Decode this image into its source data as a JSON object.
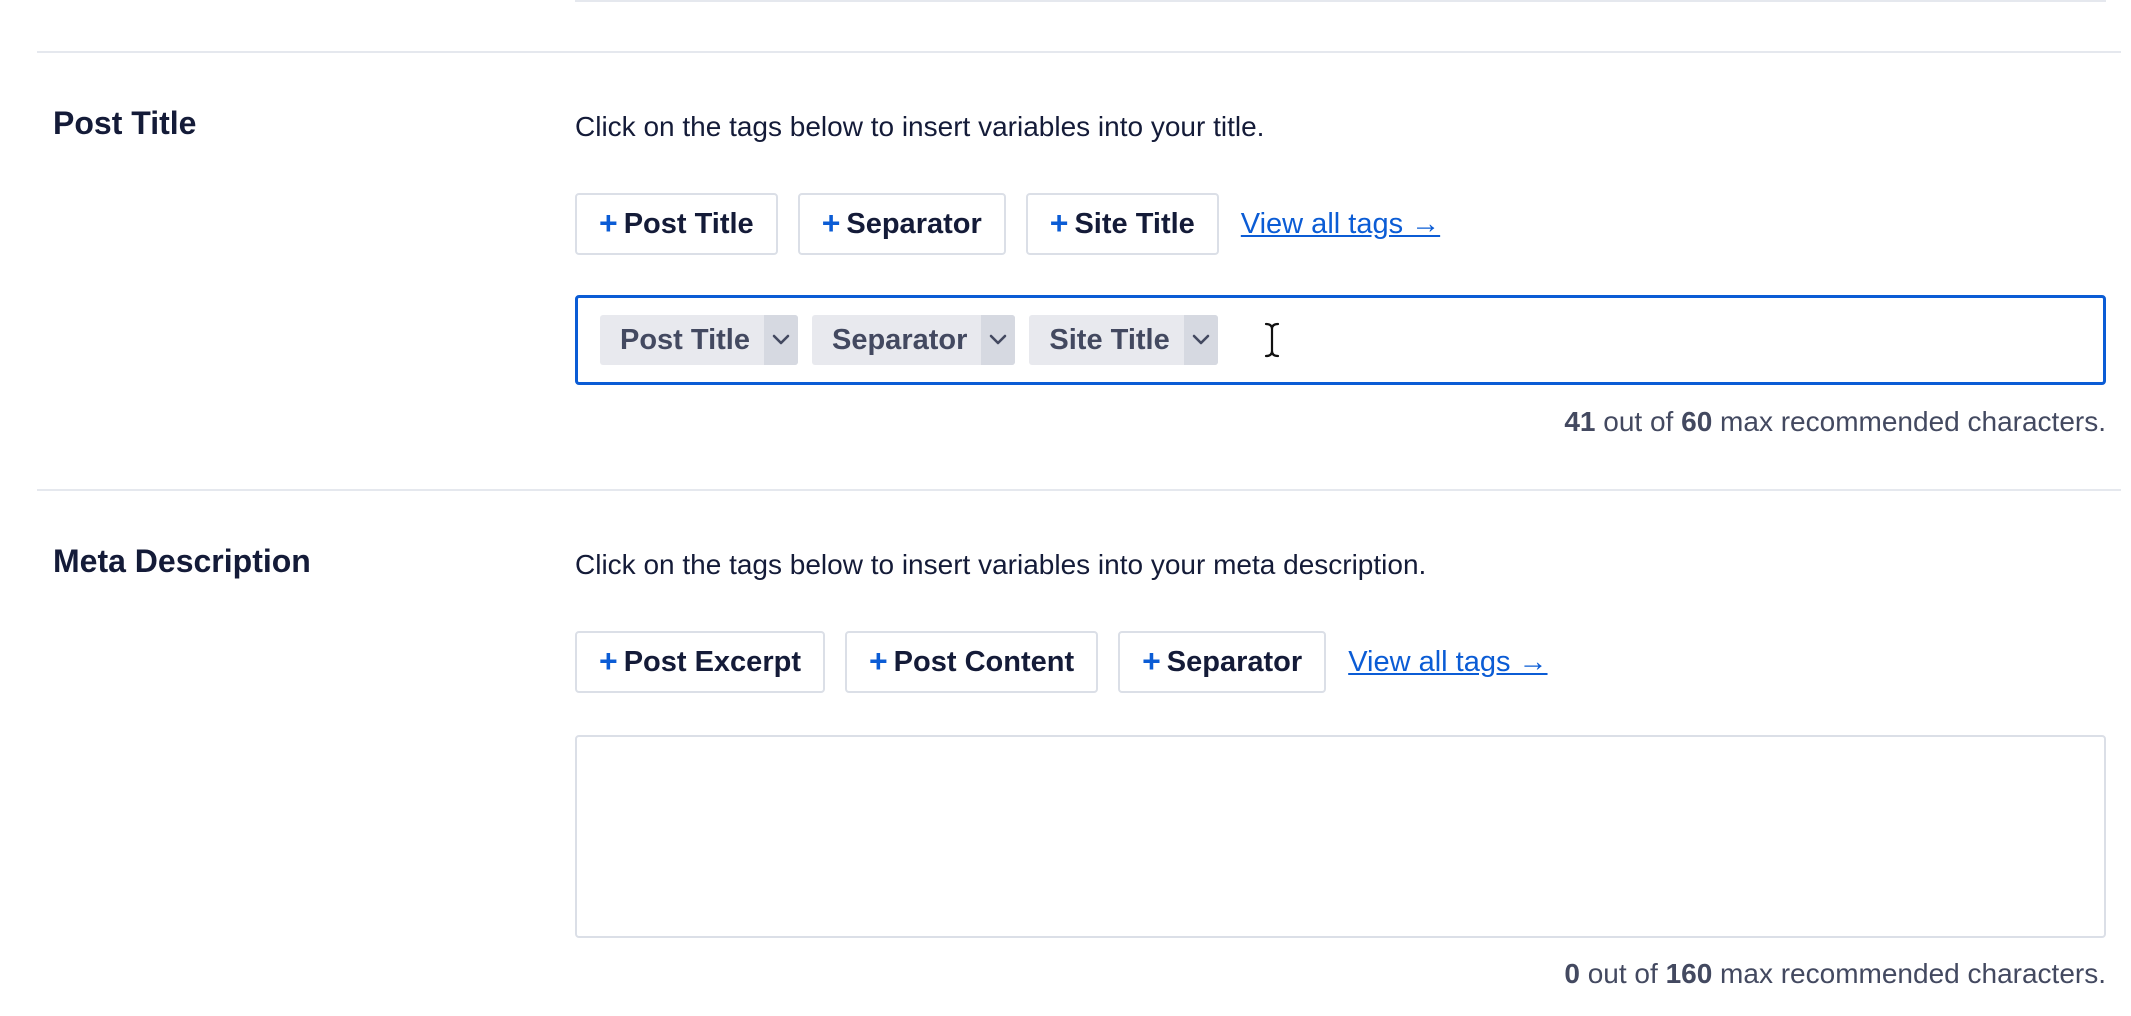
{
  "post_title_section": {
    "heading": "Post Title",
    "description": "Click on the tags below to insert variables into your title.",
    "tag_buttons": [
      {
        "plus": "+",
        "label": "Post Title"
      },
      {
        "plus": "+",
        "label": "Separator"
      },
      {
        "plus": "+",
        "label": "Site Title"
      }
    ],
    "view_all_tags": "View all tags →",
    "input_chips": [
      {
        "label": "Post Title"
      },
      {
        "label": "Separator"
      },
      {
        "label": "Site Title"
      }
    ],
    "char_count": {
      "current": "41",
      "mid": " out of ",
      "max": "60",
      "suffix": " max recommended characters."
    }
  },
  "meta_description_section": {
    "heading": "Meta Description",
    "description": "Click on the tags below to insert variables into your meta description.",
    "tag_buttons": [
      {
        "plus": "+",
        "label": "Post Excerpt"
      },
      {
        "plus": "+",
        "label": "Post Content"
      },
      {
        "plus": "+",
        "label": "Separator"
      }
    ],
    "view_all_tags": "View all tags →",
    "textarea_value": "",
    "char_count": {
      "current": "0",
      "mid": " out of ",
      "max": "160",
      "suffix": " max recommended characters."
    }
  },
  "colors": {
    "accent": "#0b5cd5",
    "text_primary": "#141b38",
    "text_secondary": "#434960",
    "chip_bg": "#e8e9ee",
    "border": "#dbdfe7"
  },
  "icons": {
    "chip_toggle": "chevron-down-icon",
    "cursor": "i-beam-cursor-icon"
  }
}
